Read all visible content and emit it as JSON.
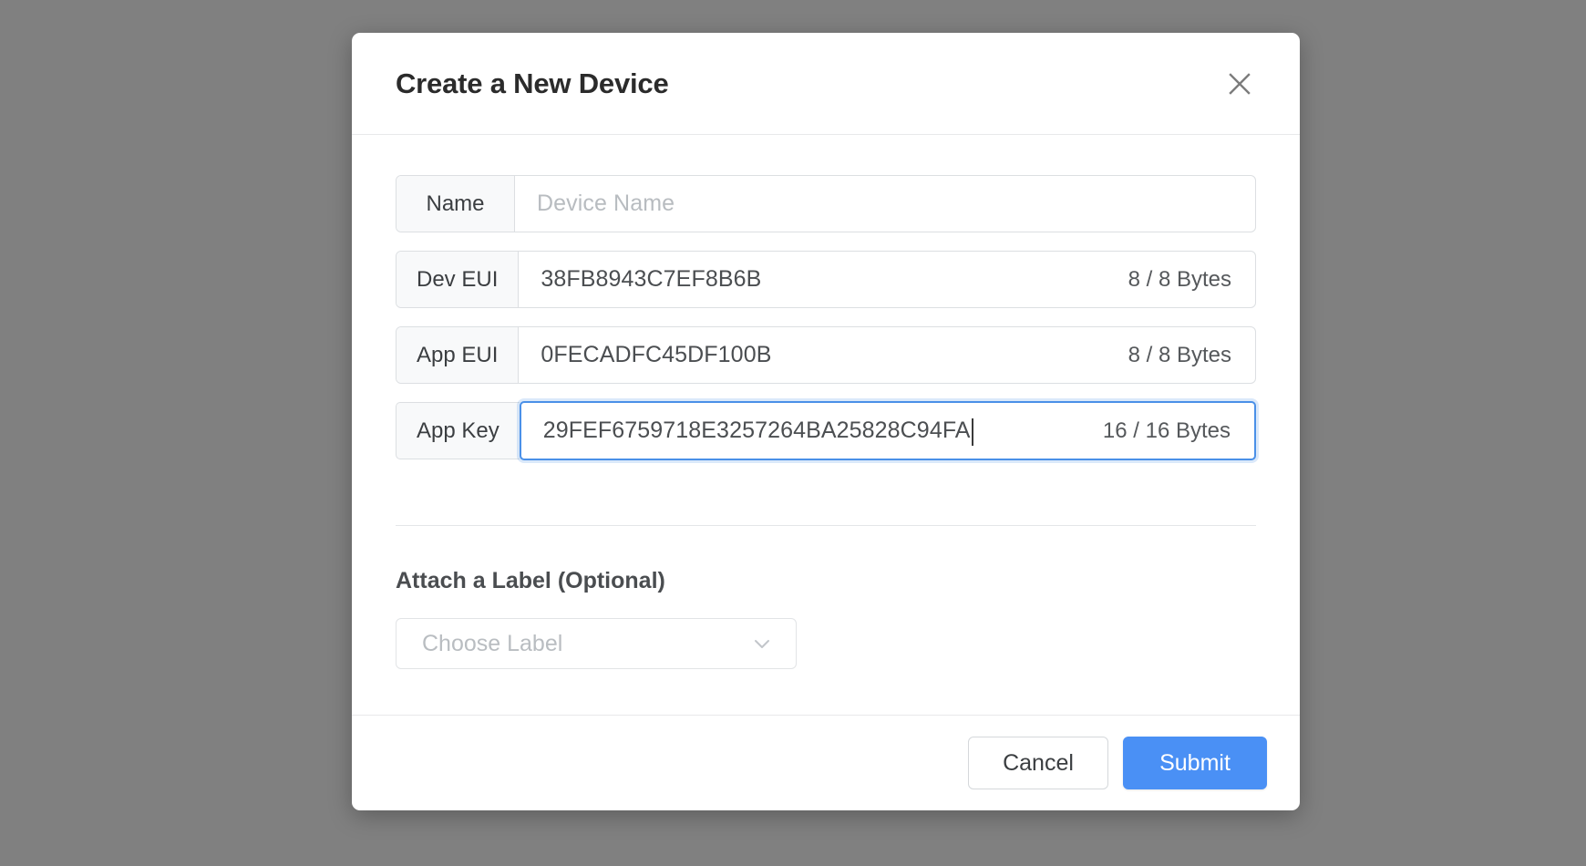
{
  "dialog": {
    "title": "Create a New Device",
    "close_icon": "close-icon"
  },
  "fields": [
    {
      "label": "Name",
      "value": "",
      "placeholder": "Device Name",
      "byte_count": "",
      "focused": false
    },
    {
      "label": "Dev EUI",
      "value": "38FB8943C7EF8B6B",
      "placeholder": "",
      "byte_count": "8 / 8 Bytes",
      "focused": false
    },
    {
      "label": "App EUI",
      "value": "0FECADFC45DF100B",
      "placeholder": "",
      "byte_count": "8 / 8 Bytes",
      "focused": false
    },
    {
      "label": "App Key",
      "value": "29FEF6759718E3257264BA25828C94FA",
      "placeholder": "",
      "byte_count": "16 / 16 Bytes",
      "focused": true
    }
  ],
  "label_section": {
    "title": "Attach a Label (Optional)",
    "select_placeholder": "Choose Label",
    "chevron_icon": "chevron-down-icon"
  },
  "footer": {
    "cancel_label": "Cancel",
    "submit_label": "Submit"
  },
  "colors": {
    "accent": "#4a90f5",
    "focus_border": "#4a90e8",
    "backdrop": "#808080",
    "label_cell_bg": "#f8f9fa",
    "border": "#dcdfe2",
    "text_primary": "#2b2b2b",
    "text_secondary": "#4b4e51",
    "placeholder": "#b8bcc0"
  }
}
